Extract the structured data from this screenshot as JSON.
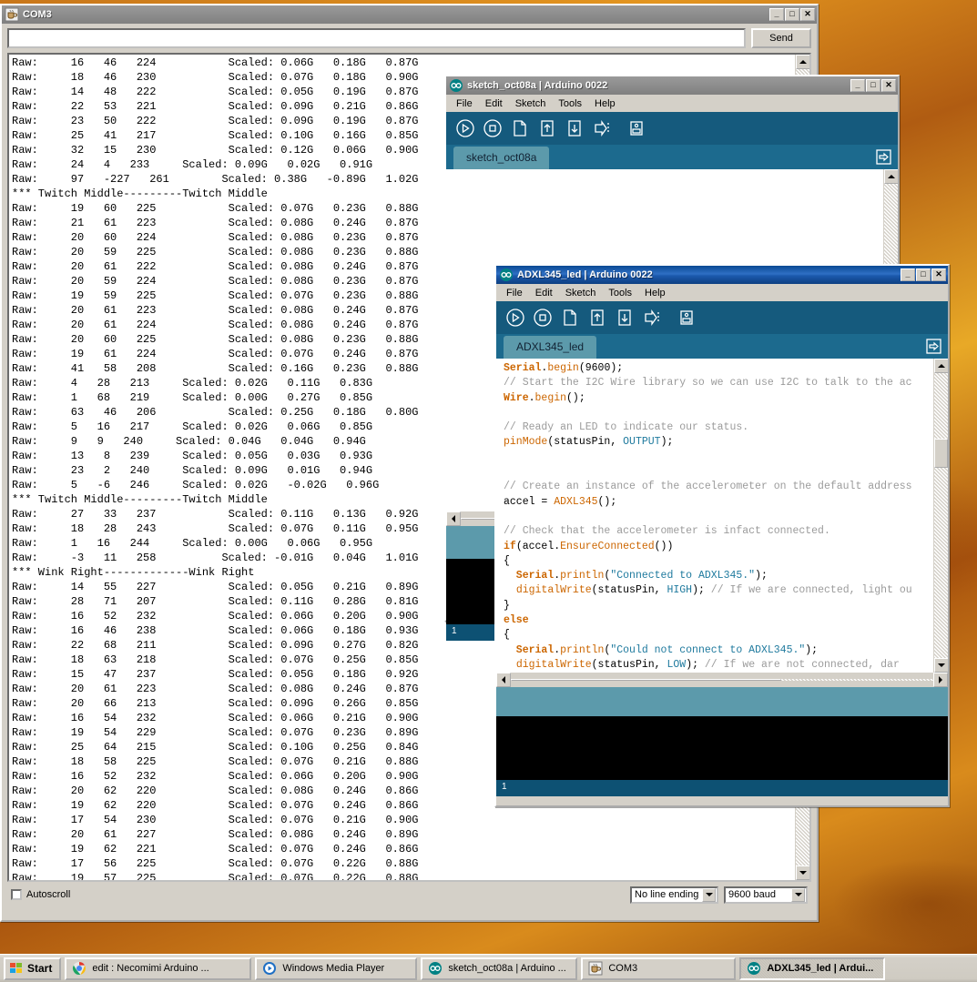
{
  "desktop": {
    "wallpaper_theme": "autumn-leaves"
  },
  "serial_monitor": {
    "title": "COM3",
    "icon": "java-coffee-cup-icon",
    "send_button": "Send",
    "input_value": "",
    "autoscroll_label": "Autoscroll",
    "autoscroll_checked": false,
    "line_ending": "No line ending",
    "baud_rate": "9600 baud",
    "window_buttons": [
      "minimize",
      "maximize",
      "close"
    ],
    "output": "Raw:     16   46   224           Scaled: 0.06G   0.18G   0.87G\nRaw:     18   46   230           Scaled: 0.07G   0.18G   0.90G\nRaw:     14   48   222           Scaled: 0.05G   0.19G   0.87G\nRaw:     22   53   221           Scaled: 0.09G   0.21G   0.86G\nRaw:     23   50   222           Scaled: 0.09G   0.19G   0.87G\nRaw:     25   41   217           Scaled: 0.10G   0.16G   0.85G\nRaw:     32   15   230           Scaled: 0.12G   0.06G   0.90G\nRaw:     24   4   233     Scaled: 0.09G   0.02G   0.91G\nRaw:     97   -227   261        Scaled: 0.38G   -0.89G   1.02G\n*** Twitch Middle---------Twitch Middle\nRaw:     19   60   225           Scaled: 0.07G   0.23G   0.88G\nRaw:     21   61   223           Scaled: 0.08G   0.24G   0.87G\nRaw:     20   60   224           Scaled: 0.08G   0.23G   0.87G\nRaw:     20   59   225           Scaled: 0.08G   0.23G   0.88G\nRaw:     20   61   222           Scaled: 0.08G   0.24G   0.87G\nRaw:     20   59   224           Scaled: 0.08G   0.23G   0.87G\nRaw:     19   59   225           Scaled: 0.07G   0.23G   0.88G\nRaw:     20   61   223           Scaled: 0.08G   0.24G   0.87G\nRaw:     20   61   224           Scaled: 0.08G   0.24G   0.87G\nRaw:     20   60   225           Scaled: 0.08G   0.23G   0.88G\nRaw:     19   61   224           Scaled: 0.07G   0.24G   0.87G\nRaw:     41   58   208           Scaled: 0.16G   0.23G   0.88G\nRaw:     4   28   213     Scaled: 0.02G   0.11G   0.83G\nRaw:     1   68   219     Scaled: 0.00G   0.27G   0.85G\nRaw:     63   46   206           Scaled: 0.25G   0.18G   0.80G\nRaw:     5   16   217     Scaled: 0.02G   0.06G   0.85G\nRaw:     9   9   240     Scaled: 0.04G   0.04G   0.94G\nRaw:     13   8   239     Scaled: 0.05G   0.03G   0.93G\nRaw:     23   2   240     Scaled: 0.09G   0.01G   0.94G\nRaw:     5   -6   246     Scaled: 0.02G   -0.02G   0.96G\n*** Twitch Middle---------Twitch Middle\nRaw:     27   33   237           Scaled: 0.11G   0.13G   0.92G\nRaw:     18   28   243           Scaled: 0.07G   0.11G   0.95G\nRaw:     1   16   244     Scaled: 0.00G   0.06G   0.95G\nRaw:     -3   11   258          Scaled: -0.01G   0.04G   1.01G\n*** Wink Right-------------Wink Right\nRaw:     14   55   227           Scaled: 0.05G   0.21G   0.89G\nRaw:     28   71   207           Scaled: 0.11G   0.28G   0.81G\nRaw:     16   52   232           Scaled: 0.06G   0.20G   0.90G\nRaw:     16   46   238           Scaled: 0.06G   0.18G   0.93G\nRaw:     22   68   211           Scaled: 0.09G   0.27G   0.82G\nRaw:     18   63   218           Scaled: 0.07G   0.25G   0.85G\nRaw:     15   47   237           Scaled: 0.05G   0.18G   0.92G\nRaw:     20   61   223           Scaled: 0.08G   0.24G   0.87G\nRaw:     20   66   213           Scaled: 0.09G   0.26G   0.85G\nRaw:     16   54   232           Scaled: 0.06G   0.21G   0.90G\nRaw:     19   54   229           Scaled: 0.07G   0.23G   0.89G\nRaw:     25   64   215           Scaled: 0.10G   0.25G   0.84G\nRaw:     18   58   225           Scaled: 0.07G   0.21G   0.88G\nRaw:     16   52   232           Scaled: 0.06G   0.20G   0.90G\nRaw:     20   62   220           Scaled: 0.08G   0.24G   0.86G\nRaw:     19   62   220           Scaled: 0.07G   0.24G   0.86G\nRaw:     17   54   230           Scaled: 0.07G   0.21G   0.90G\nRaw:     20   61   227           Scaled: 0.08G   0.24G   0.89G\nRaw:     19   62   221           Scaled: 0.07G   0.24G   0.86G\nRaw:     17   56   225           Scaled: 0.07G   0.22G   0.88G\nRaw:     19   57   225           Scaled: 0.07G   0.22G   0.88G"
  },
  "sketch_window": {
    "title": "sketch_oct08a | Arduino 0022",
    "icon": "arduino-infinity-icon",
    "menu": [
      "File",
      "Edit",
      "Sketch",
      "Tools",
      "Help"
    ],
    "toolbar_icons": [
      "verify-icon",
      "stop-icon",
      "new-icon",
      "open-icon",
      "save-icon",
      "upload-icon",
      "serial-monitor-icon"
    ],
    "tab_label": "sketch_oct08a",
    "tab_arrow_icon": "tab-menu-arrow-icon",
    "code": "",
    "line_number": "1"
  },
  "adxl_window": {
    "title": "ADXL345_led | Arduino 0022",
    "icon": "arduino-infinity-icon",
    "menu": [
      "File",
      "Edit",
      "Sketch",
      "Tools",
      "Help"
    ],
    "toolbar_icons": [
      "verify-icon",
      "stop-icon",
      "new-icon",
      "open-icon",
      "save-icon",
      "upload-icon",
      "serial-monitor-icon"
    ],
    "tab_label": "ADXL345_led",
    "tab_arrow_icon": "tab-menu-arrow-icon",
    "line_number": "1",
    "code_lines": [
      [
        {
          "t": "Serial",
          "c": "kw"
        },
        {
          "t": ".",
          "c": "plain"
        },
        {
          "t": "begin",
          "c": "fn"
        },
        {
          "t": "(9600);",
          "c": "plain"
        }
      ],
      [
        {
          "t": "// Start the I2C Wire library so we can use I2C to talk to the ac",
          "c": "cmt"
        }
      ],
      [
        {
          "t": "Wire",
          "c": "kw"
        },
        {
          "t": ".",
          "c": "plain"
        },
        {
          "t": "begin",
          "c": "fn"
        },
        {
          "t": "();",
          "c": "plain"
        }
      ],
      [],
      [
        {
          "t": "// Ready an LED to indicate our status.",
          "c": "cmt"
        }
      ],
      [
        {
          "t": "pinMode",
          "c": "fn"
        },
        {
          "t": "(statusPin, ",
          "c": "plain"
        },
        {
          "t": "OUTPUT",
          "c": "lit"
        },
        {
          "t": ");",
          "c": "plain"
        }
      ],
      [],
      [],
      [
        {
          "t": "// Create an instance of the accelerometer on the default address",
          "c": "cmt"
        }
      ],
      [
        {
          "t": "accel = ",
          "c": "plain"
        },
        {
          "t": "ADXL345",
          "c": "fn"
        },
        {
          "t": "();",
          "c": "plain"
        }
      ],
      [],
      [
        {
          "t": "// Check that the accelerometer is infact connected.",
          "c": "cmt"
        }
      ],
      [
        {
          "t": "if",
          "c": "kw"
        },
        {
          "t": "(accel.",
          "c": "plain"
        },
        {
          "t": "EnsureConnected",
          "c": "fn"
        },
        {
          "t": "())",
          "c": "plain"
        }
      ],
      [
        {
          "t": "{",
          "c": "plain"
        }
      ],
      [
        {
          "t": "  Serial",
          "c": "kw"
        },
        {
          "t": ".",
          "c": "plain"
        },
        {
          "t": "println",
          "c": "fn"
        },
        {
          "t": "(",
          "c": "plain"
        },
        {
          "t": "\"Connected to ADXL345.\"",
          "c": "str"
        },
        {
          "t": ");",
          "c": "plain"
        }
      ],
      [
        {
          "t": "  ",
          "c": "plain"
        },
        {
          "t": "digitalWrite",
          "c": "fn"
        },
        {
          "t": "(statusPin, ",
          "c": "plain"
        },
        {
          "t": "HIGH",
          "c": "lit"
        },
        {
          "t": "); ",
          "c": "plain"
        },
        {
          "t": "// If we are connected, light ou",
          "c": "cmt"
        }
      ],
      [
        {
          "t": "}",
          "c": "plain"
        }
      ],
      [
        {
          "t": "else",
          "c": "kw"
        }
      ],
      [
        {
          "t": "{",
          "c": "plain"
        }
      ],
      [
        {
          "t": "  Serial",
          "c": "kw"
        },
        {
          "t": ".",
          "c": "plain"
        },
        {
          "t": "println",
          "c": "fn"
        },
        {
          "t": "(",
          "c": "plain"
        },
        {
          "t": "\"Could not connect to ADXL345.\"",
          "c": "str"
        },
        {
          "t": ");",
          "c": "plain"
        }
      ],
      [
        {
          "t": "  ",
          "c": "plain"
        },
        {
          "t": "digitalWrite",
          "c": "fn"
        },
        {
          "t": "(statusPin, ",
          "c": "plain"
        },
        {
          "t": "LOW",
          "c": "lit"
        },
        {
          "t": "); ",
          "c": "plain"
        },
        {
          "t": "// If we are not connected, dar",
          "c": "cmt"
        }
      ]
    ]
  },
  "taskbar": {
    "start_label": "Start",
    "start_icon": "windows-flag-icon",
    "items": [
      {
        "label": "edit : Necomimi Arduino ...",
        "icon": "chrome-icon",
        "active": false
      },
      {
        "label": "Windows Media Player",
        "icon": "wmp-icon",
        "active": false
      },
      {
        "label": "sketch_oct08a | Arduino ...",
        "icon": "arduino-infinity-icon",
        "active": false
      },
      {
        "label": "COM3",
        "icon": "java-coffee-cup-icon",
        "active": false
      },
      {
        "label": "ADXL345_led | Ardui...",
        "icon": "arduino-infinity-icon",
        "active": true
      }
    ]
  },
  "colors": {
    "chrome_face": "#d4d0c8",
    "title_active": "#0a4a93",
    "title_inactive": "#808080",
    "arduino_toolbar": "#155a7d",
    "arduino_tabbar": "#1c6a8e",
    "arduino_tab": "#5c9aab",
    "arduino_status": "#5c9aab",
    "arduino_console": "#000000",
    "arduino_linebar": "#0d5173",
    "syntax_keyword": "#cc6600",
    "syntax_comment": "#9b9b9b",
    "syntax_string": "#1f7a9e"
  }
}
